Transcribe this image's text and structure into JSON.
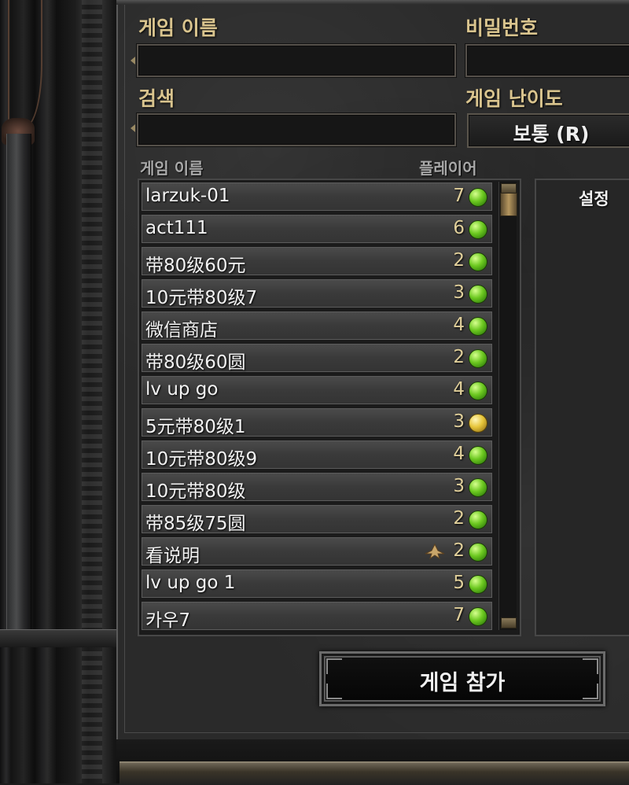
{
  "form": {
    "game_name_label": "게임 이름",
    "password_label": "비밀번호",
    "search_label": "검색",
    "difficulty_label": "게임 난이도",
    "difficulty_value": "보통 (R)"
  },
  "list": {
    "col_name": "게임 이름",
    "col_players": "플레이어",
    "rows": [
      {
        "name": "larzuk-01",
        "players": "7",
        "status": "green"
      },
      {
        "name": "act111",
        "players": "6",
        "status": "green"
      },
      {
        "name": "带80级60元",
        "players": "2",
        "status": "green"
      },
      {
        "name": "10元带80级7",
        "players": "3",
        "status": "green"
      },
      {
        "name": "微信商店",
        "players": "4",
        "status": "green"
      },
      {
        "name": "带80级60圆",
        "players": "2",
        "status": "green"
      },
      {
        "name": "lv up go",
        "players": "4",
        "status": "green"
      },
      {
        "name": "5元带80级1",
        "players": "3",
        "status": "yellow"
      },
      {
        "name": "10元带80级9",
        "players": "4",
        "status": "green"
      },
      {
        "name": "10元带80级",
        "players": "3",
        "status": "green"
      },
      {
        "name": "带85级75圆",
        "players": "2",
        "status": "green"
      },
      {
        "name": "看说明",
        "players": "2",
        "status": "green",
        "ladder_icon": "ladder-wings-icon"
      },
      {
        "name": "lv up go 1",
        "players": "5",
        "status": "green"
      },
      {
        "name": "카우7",
        "players": "7",
        "status": "green"
      }
    ]
  },
  "settings": {
    "title": "설정"
  },
  "join_button": "게임 참가",
  "colors": {
    "label_gold": "#d9c48e",
    "status_green": "#6cc820",
    "status_yellow": "#e6c53a"
  }
}
